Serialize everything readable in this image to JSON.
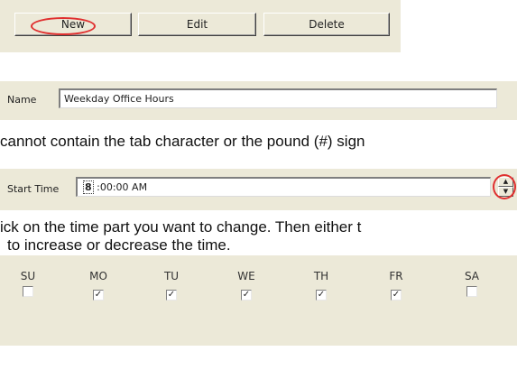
{
  "toolbar": {
    "new_label": "New",
    "edit_label": "Edit",
    "delete_label": "Delete"
  },
  "name_field": {
    "label": "Name",
    "value": "Weekday Office Hours"
  },
  "captions": {
    "name_note": "cannot contain the tab character or the pound (#) sign",
    "time_note_1": "ick on the time part you want to change. Then either t",
    "time_note_2": "to increase or decrease the time."
  },
  "start_time": {
    "label": "Start Time",
    "hour": "8",
    "rest": " :00:00 AM",
    "spin_up": "up-arrow-icon",
    "spin_down": "down-arrow-icon"
  },
  "days": [
    {
      "label": "SU",
      "checked": false
    },
    {
      "label": "MO",
      "checked": true
    },
    {
      "label": "TU",
      "checked": true
    },
    {
      "label": "WE",
      "checked": true
    },
    {
      "label": "TH",
      "checked": true
    },
    {
      "label": "FR",
      "checked": true
    },
    {
      "label": "SA",
      "checked": false
    }
  ],
  "colors": {
    "panel": "#ece9d8",
    "highlight": "#e03030"
  }
}
